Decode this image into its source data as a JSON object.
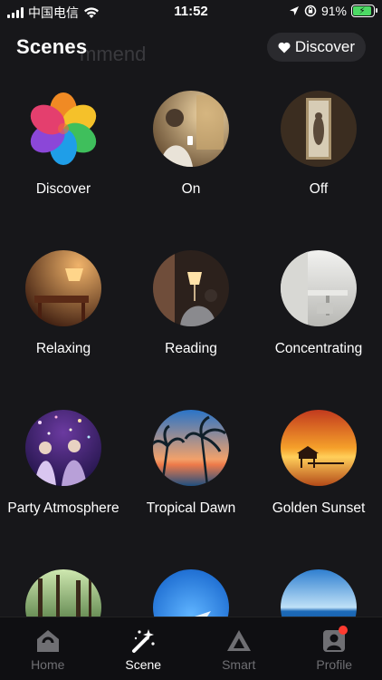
{
  "status_bar": {
    "carrier": "中国电信",
    "time": "11:52",
    "battery_percent": "91%",
    "battery_level": 0.91
  },
  "header": {
    "title": "Scenes",
    "ghost_text": "mmend",
    "discover_label": "Discover"
  },
  "scenes": [
    {
      "label": "Discover"
    },
    {
      "label": "On"
    },
    {
      "label": "Off"
    },
    {
      "label": "Relaxing"
    },
    {
      "label": "Reading"
    },
    {
      "label": "Concentrating"
    },
    {
      "label": "Party Atmosphere"
    },
    {
      "label": "Tropical Dawn"
    },
    {
      "label": "Golden Sunset"
    },
    {
      "label": ""
    },
    {
      "label": ""
    },
    {
      "label": ""
    }
  ],
  "tabs": [
    {
      "label": "Home",
      "icon": "home-icon",
      "active": false
    },
    {
      "label": "Scene",
      "icon": "magic-wand-icon",
      "active": true
    },
    {
      "label": "Smart",
      "icon": "smart-icon",
      "active": false
    },
    {
      "label": "Profile",
      "icon": "profile-icon",
      "active": false
    }
  ],
  "colors": {
    "background": "#17171a",
    "tabbar": "#0f0f12",
    "active_tab": "#ffffff",
    "inactive_tab": "#6f6f73",
    "badge": "#ff3b30",
    "battery_fill": "#4cd964"
  }
}
